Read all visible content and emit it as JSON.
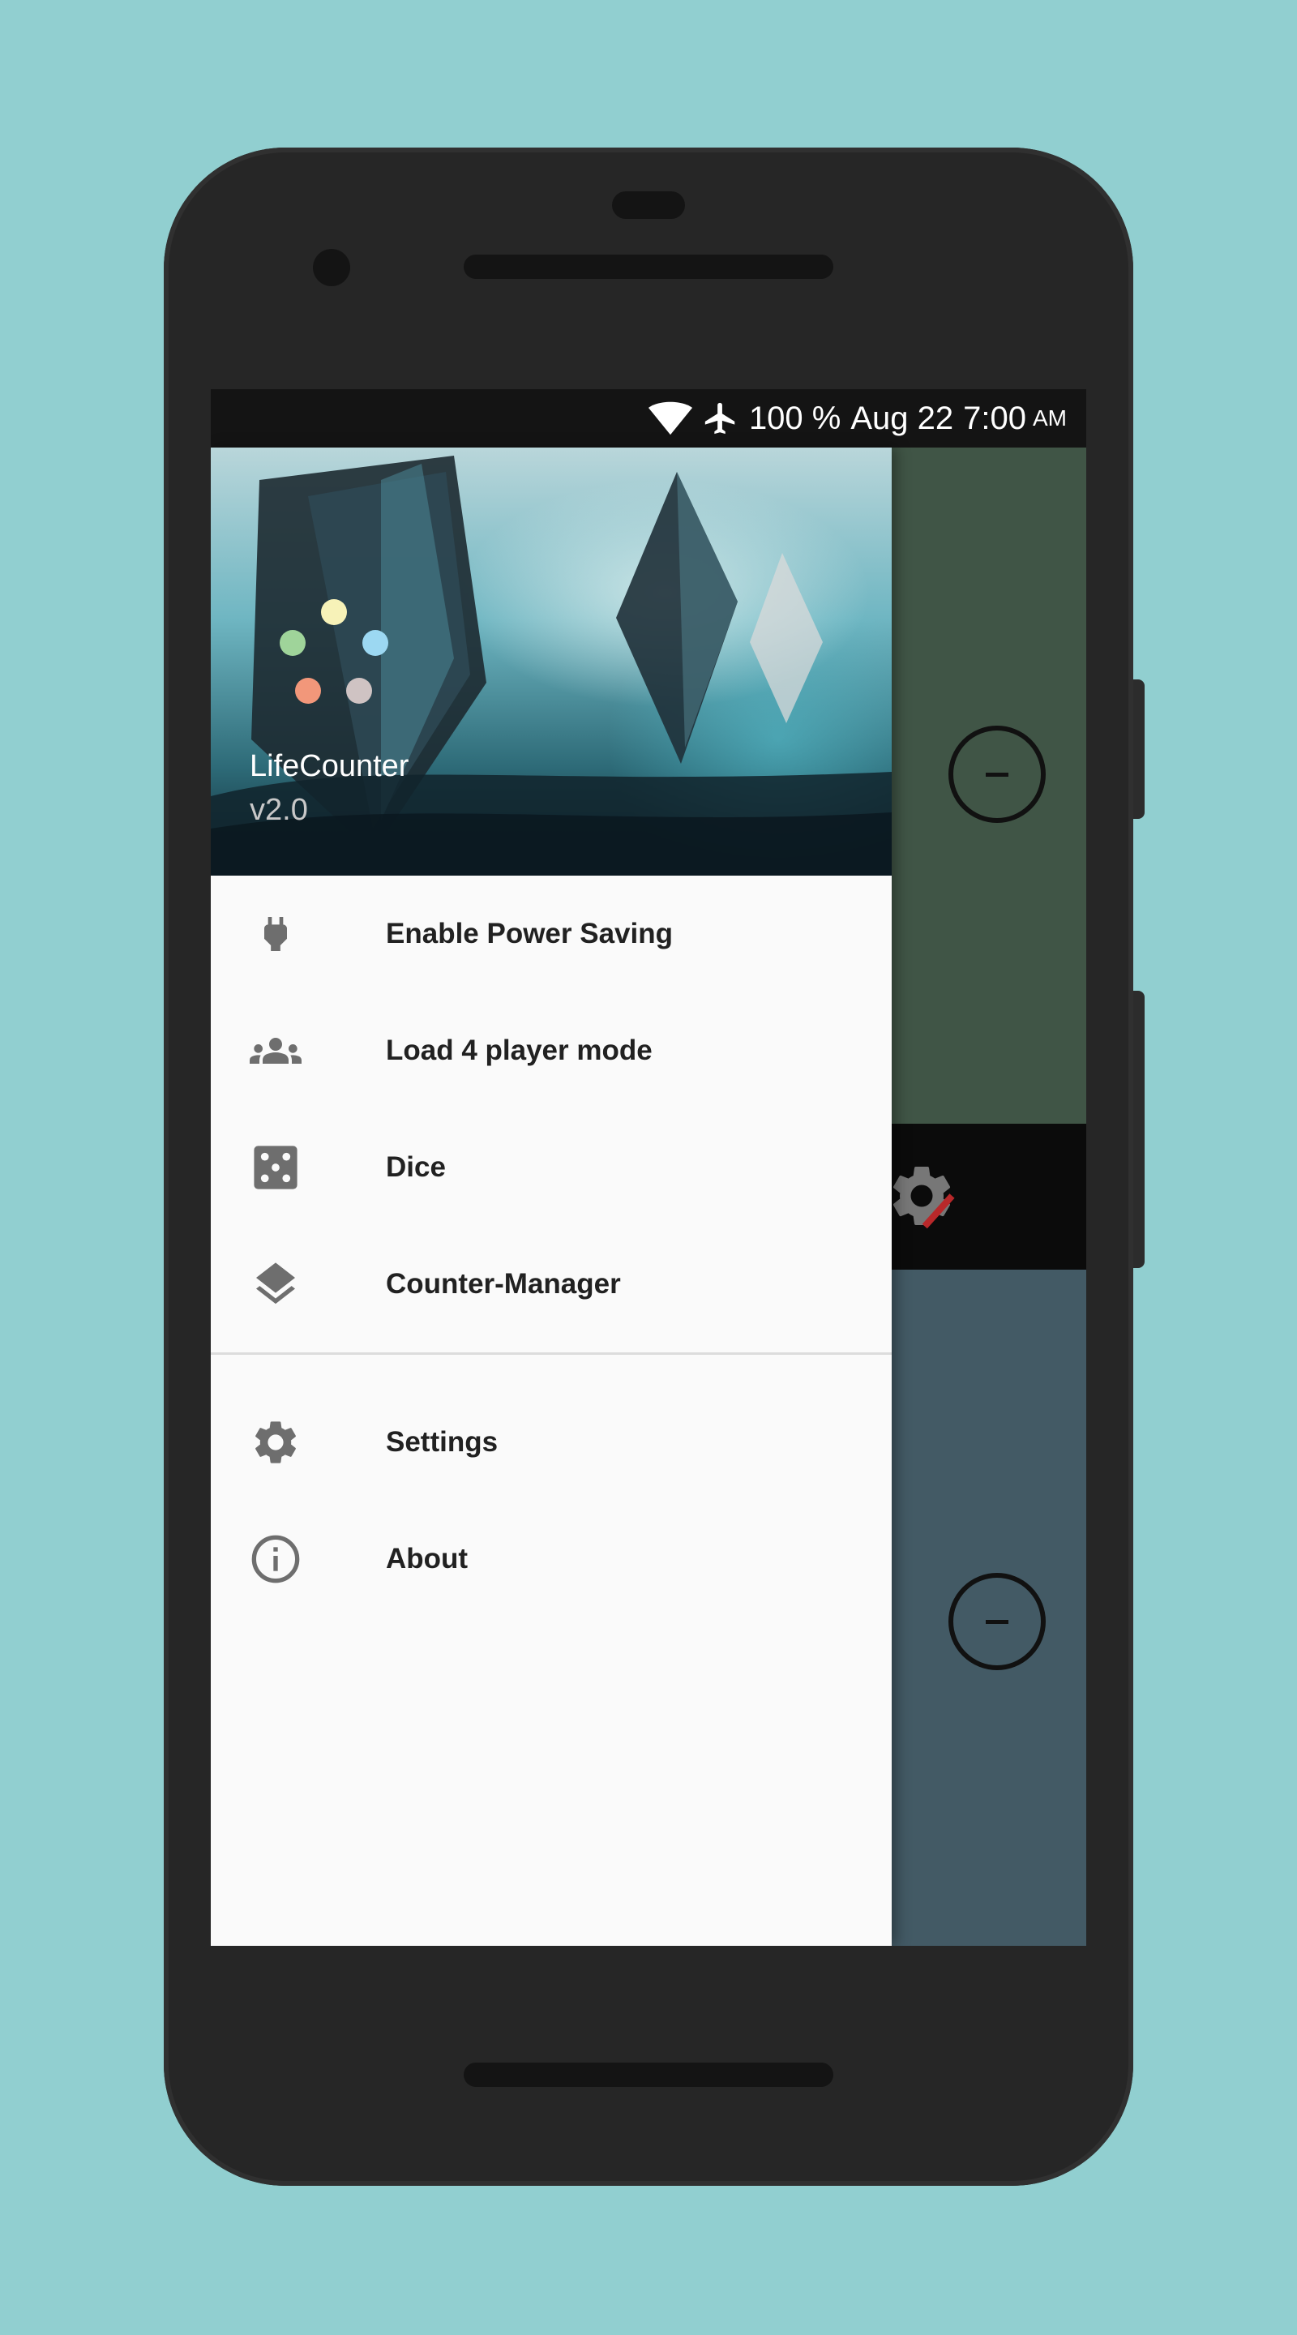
{
  "status_bar": {
    "battery": "100 %",
    "date": "Aug 22",
    "time": "7:00",
    "ampm": "AM"
  },
  "drawer": {
    "app_name": "LifeCounter",
    "version": "v2.0",
    "menu_items": [
      {
        "label": "Enable Power Saving",
        "icon": "power-plug-icon"
      },
      {
        "label": "Load 4 player mode",
        "icon": "group-icon"
      },
      {
        "label": "Dice",
        "icon": "dice-icon"
      },
      {
        "label": "Counter-Manager",
        "icon": "layers-icon"
      }
    ],
    "secondary_items": [
      {
        "label": "Settings",
        "icon": "gear-icon"
      },
      {
        "label": "About",
        "icon": "info-icon"
      }
    ]
  },
  "colors": {
    "background": "#91cfd0",
    "phone_body": "#262626",
    "player1_panel": "#405546",
    "player2_panel": "#435a65",
    "drawer_bg": "#fafafa",
    "icon_gray": "#6e6e6e",
    "logo_dots": [
      "#f7f2b8",
      "#9fd49a",
      "#9cd8f2",
      "#f2977a",
      "#cfc3c3"
    ]
  }
}
